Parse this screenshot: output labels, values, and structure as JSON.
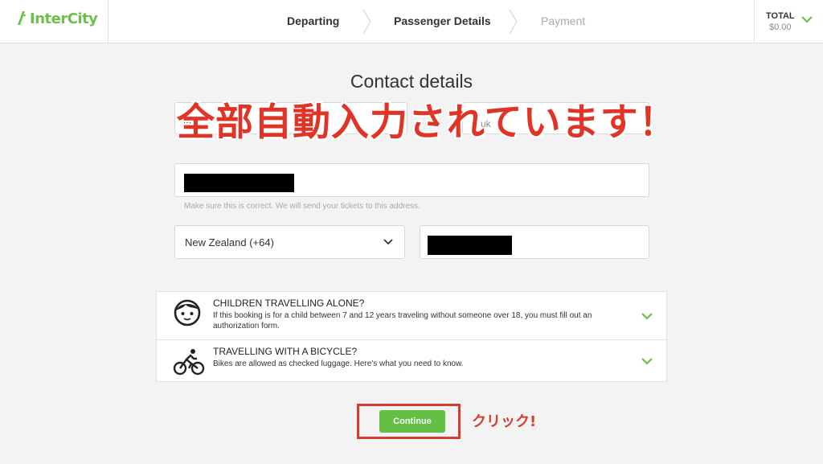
{
  "header": {
    "logo_text": "InterCity",
    "steps": [
      "Departing",
      "Passenger Details",
      "Payment"
    ],
    "total_label": "TOTAL",
    "total_value": "$0.00"
  },
  "contact": {
    "title": "Contact details",
    "last_name_partial": "uk",
    "helper_text": "Make sure this is correct. We will send your tickets to this address.",
    "country_select_value": "New Zealand (+64)"
  },
  "overlay": {
    "text": "全部自動入力されています！"
  },
  "info": [
    {
      "title": "CHILDREN TRAVELLING ALONE?",
      "desc": "If this booking is for a child between 7 and 12 years traveling without someone over 18, you must fill out an authorization form.",
      "icon": "child-face-icon"
    },
    {
      "title": "TRAVELLING WITH A BICYCLE?",
      "desc": "Bikes are allowed as checked luggage. Here's what you need to know.",
      "icon": "bicycle-icon"
    }
  ],
  "actions": {
    "continue_label": "Continue",
    "click_note": "クリック!"
  },
  "colors": {
    "brand_green": "#6cc04a",
    "button_green": "#64bf45",
    "annotation_red": "#d33e2e"
  }
}
